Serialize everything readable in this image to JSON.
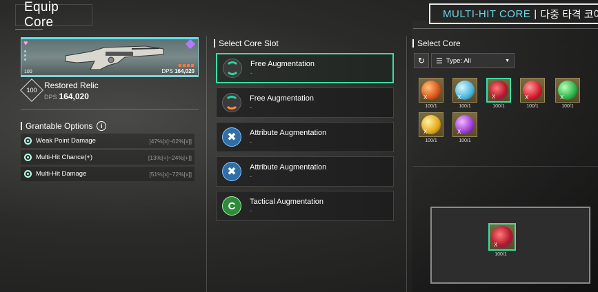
{
  "header": {
    "title": "Equip Core",
    "banner_en": "MULTI-HIT CORE",
    "banner_sep": "|",
    "banner_ko": "다중 타격 코어"
  },
  "weapon": {
    "level_text": "100",
    "dps_label": "DPS",
    "dps_value": "164,020",
    "name": "Restored Relic",
    "badge": "100",
    "dps_text": "DPS",
    "dps_big": "164,020"
  },
  "options": {
    "heading": "Grantable Options",
    "info_icon": "i",
    "items": [
      {
        "label": "Weak Point Damage",
        "range": "[47%[x]~62%[x]]"
      },
      {
        "label": "Multi-Hit Chance(+)",
        "range": "[13%[+]~24%[+]]"
      },
      {
        "label": "Multi-Hit Damage",
        "range": "[51%[x]~72%[x]]"
      }
    ]
  },
  "slots": {
    "heading": "Select Core Slot",
    "items": [
      {
        "title": "Free Augmentation",
        "sub": "-",
        "icon": "free-augmentation-icon",
        "selected": true
      },
      {
        "title": "Free Augmentation",
        "sub": "-",
        "icon": "free-augmentation-icon",
        "selected": false
      },
      {
        "title": "Attribute Augmentation",
        "sub": "-",
        "icon": "attribute-augmentation-icon",
        "selected": false
      },
      {
        "title": "Attribute Augmentation",
        "sub": "-",
        "icon": "attribute-augmentation-icon",
        "selected": false
      },
      {
        "title": "Tactical Augmentation",
        "sub": "-",
        "icon": "tactical-augmentation-icon",
        "selected": false
      }
    ]
  },
  "select_core": {
    "heading": "Select Core",
    "refresh_icon": "refresh-icon",
    "type_label": "Type: All",
    "cores": [
      {
        "color": "orange",
        "count": "100/1",
        "mark": "X"
      },
      {
        "color": "blue",
        "count": "100/1",
        "mark": "X"
      },
      {
        "color": "redblue",
        "count": "100/1",
        "mark": "X",
        "selected": true
      },
      {
        "color": "red",
        "count": "100/1",
        "mark": "X"
      },
      {
        "color": "green",
        "count": "100/1",
        "mark": "X"
      },
      {
        "color": "yellow",
        "count": "100/1",
        "mark": "X"
      },
      {
        "color": "purple",
        "count": "100/1",
        "mark": "X"
      }
    ],
    "preview": {
      "count": "100/1",
      "mark": "X"
    }
  },
  "colors": {
    "accent": "#38e0a4",
    "banner_text": "#6fd6e6"
  }
}
